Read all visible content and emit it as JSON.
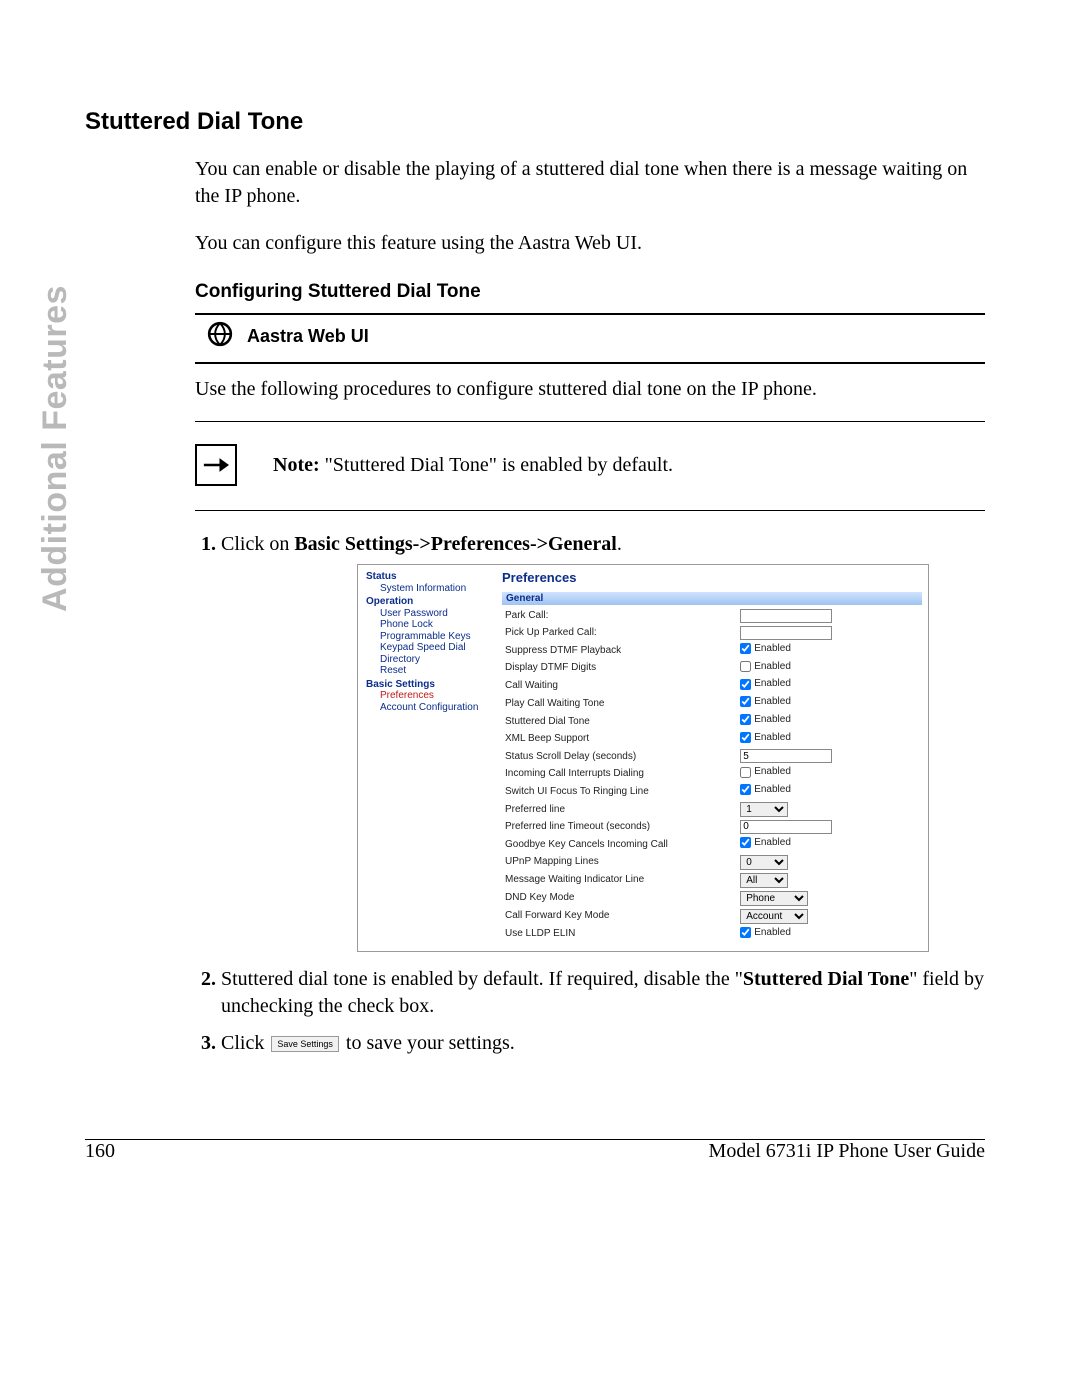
{
  "sidebar_label": "Additional Features",
  "title": "Stuttered Dial Tone",
  "para1": "You can enable or disable the playing of a stuttered dial tone when there is a message waiting on the IP phone.",
  "para2": "You can configure this feature using the Aastra Web UI.",
  "subsection": "Configuring Stuttered Dial Tone",
  "webui_label": "Aastra Web UI",
  "webui_intro": "Use the following procedures to configure stuttered dial tone on the IP phone.",
  "note_label": "Note:",
  "note_text": " \"Stuttered Dial Tone\" is enabled by default.",
  "steps": {
    "s1_pre": "Click on ",
    "s1_bold": "Basic Settings->Preferences->General",
    "s1_post": ".",
    "s2_pre": "Stuttered dial tone is enabled by default. If required, disable the \"",
    "s2_bold": "Stuttered Dial Tone",
    "s2_post": "\" field by unchecking the check box.",
    "s3_pre": "Click ",
    "s3_btn": "Save Settings",
    "s3_post": " to save your settings."
  },
  "ui": {
    "nav": {
      "status": "Status",
      "system_information": "System Information",
      "operation": "Operation",
      "user_password": "User Password",
      "phone_lock": "Phone Lock",
      "programmable_keys": "Programmable Keys",
      "keypad_speed_dial": "Keypad Speed Dial",
      "directory": "Directory",
      "reset": "Reset",
      "basic_settings": "Basic Settings",
      "preferences": "Preferences",
      "account_configuration": "Account Configuration"
    },
    "prefs_title": "Preferences",
    "section_general": "General",
    "rows": {
      "park_call": "Park Call:",
      "pick_up_parked_call": "Pick Up Parked Call:",
      "suppress_dtmf_playback": "Suppress DTMF Playback",
      "display_dtmf_digits": "Display DTMF Digits",
      "call_waiting": "Call Waiting",
      "play_call_waiting_tone": "Play Call Waiting Tone",
      "stuttered_dial_tone": "Stuttered Dial Tone",
      "xml_beep_support": "XML Beep Support",
      "status_scroll_delay": "Status Scroll Delay (seconds)",
      "incoming_call_interrupts_dialing": "Incoming Call Interrupts Dialing",
      "switch_ui_focus": "Switch UI Focus To Ringing Line",
      "preferred_line": "Preferred line",
      "preferred_line_timeout": "Preferred line Timeout (seconds)",
      "goodbye_key_cancels": "Goodbye Key Cancels Incoming Call",
      "upnp_mapping_lines": "UPnP Mapping Lines",
      "mwi_line": "Message Waiting Indicator Line",
      "dnd_key_mode": "DND Key Mode",
      "cfwd_key_mode": "Call Forward Key Mode",
      "use_lldp_elin": "Use LLDP ELIN"
    },
    "values": {
      "enabled_label": "Enabled",
      "park_call": "",
      "pick_up_parked_call": "",
      "suppress_dtmf_playback": true,
      "display_dtmf_digits": false,
      "call_waiting": true,
      "play_call_waiting_tone": true,
      "stuttered_dial_tone": true,
      "xml_beep_support": true,
      "status_scroll_delay": "5",
      "incoming_call_interrupts_dialing": false,
      "switch_ui_focus": true,
      "preferred_line": "1",
      "preferred_line_timeout": "0",
      "goodbye_key_cancels": true,
      "upnp_mapping_lines": "0",
      "mwi_line": "All",
      "dnd_key_mode": "Phone",
      "cfwd_key_mode": "Account",
      "use_lldp_elin": true
    }
  },
  "footer": {
    "page": "160",
    "doc": "Model 6731i IP Phone User Guide"
  }
}
